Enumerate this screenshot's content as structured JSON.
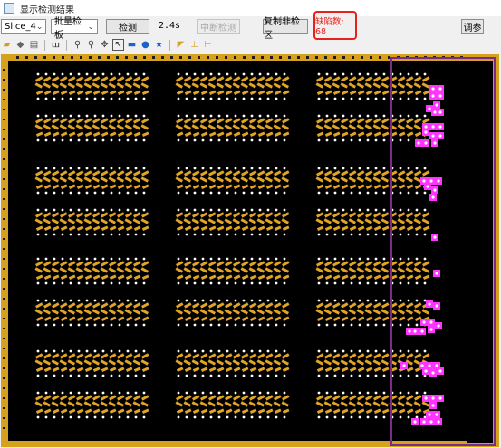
{
  "window": {
    "title": "显示检测结果"
  },
  "toolbar": {
    "slice_value": "Slice_4",
    "mode_value": "批量检板",
    "detect_label": "检测",
    "time_text": "2.4s",
    "stop_label": "中断检测",
    "copy_label": "复制非检区",
    "defect_count_text": "缺陷数: 68",
    "adjust_label": "调参"
  },
  "icons": [
    "open-folder-icon",
    "eraser-icon",
    "print-icon",
    "book-icon",
    "key-icon",
    "key-icon",
    "move-icon",
    "pointer-icon",
    "rectangle-icon",
    "circle-icon",
    "star-icon",
    "triangle-marker-icon",
    "t-marker-icon",
    "corner-marker-icon"
  ],
  "colors": {
    "board": "#000000",
    "frame": "#d6a21e",
    "pad": "#e0a426",
    "dot": "#ffffff",
    "defect": "#ff35ff",
    "roi": "#7b2c86",
    "defect_text": "#e8211b"
  }
}
